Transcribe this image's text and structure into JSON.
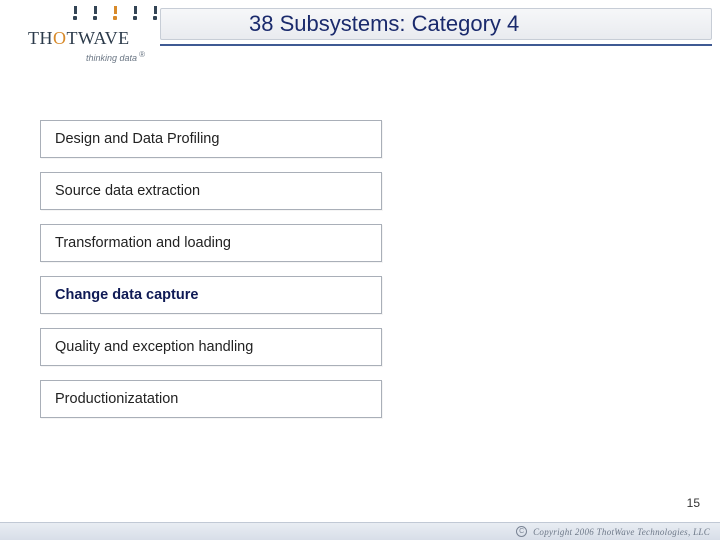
{
  "header": {
    "title": "38 Subsystems: Category 4"
  },
  "logo": {
    "brand_pre": "TH",
    "brand_o": "O",
    "brand_post": "TWAVE",
    "tagline": "thinking data",
    "registered": "®"
  },
  "items": [
    {
      "label": "Design and Data Profiling",
      "active": false
    },
    {
      "label": "Source data extraction",
      "active": false
    },
    {
      "label": "Transformation and loading",
      "active": false
    },
    {
      "label": "Change data capture",
      "active": true
    },
    {
      "label": "Quality and exception handling",
      "active": false
    },
    {
      "label": "Productionizatation",
      "active": false
    }
  ],
  "page_number": "15",
  "footer": {
    "copyright_symbol": "C",
    "text": "Copyright 2006 ThotWave Technologies, LLC"
  }
}
